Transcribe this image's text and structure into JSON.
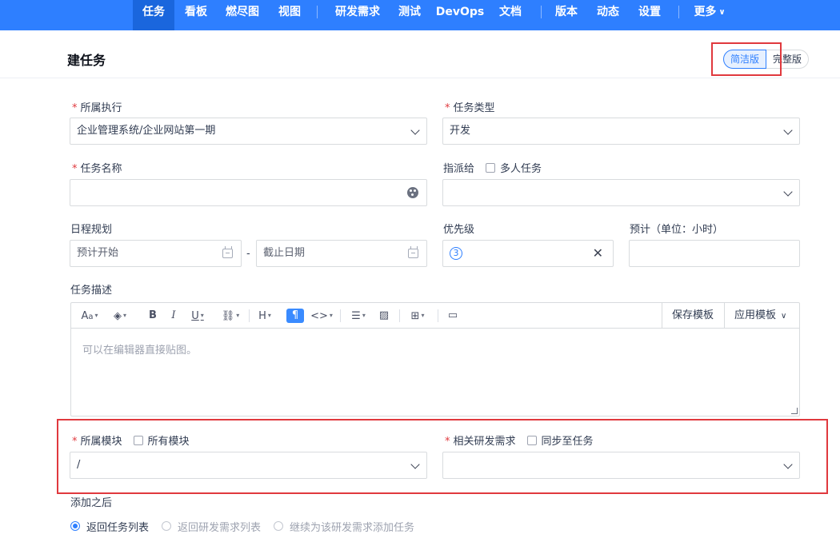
{
  "nav": {
    "items": [
      {
        "label": "任务",
        "active": true
      },
      {
        "label": "看板"
      },
      {
        "label": "燃尽图"
      },
      {
        "label": "视图"
      },
      {
        "label": "研发需求"
      },
      {
        "label": "测试"
      },
      {
        "label": "DevOps"
      },
      {
        "label": "文档"
      },
      {
        "label": "版本"
      },
      {
        "label": "动态"
      },
      {
        "label": "设置"
      },
      {
        "label": "更多"
      }
    ]
  },
  "header": {
    "title": "建任务",
    "view_simple": "简洁版",
    "view_full": "完整版"
  },
  "form": {
    "execution": {
      "label": "所属执行",
      "value": "企业管理系统/企业网站第一期"
    },
    "task_type": {
      "label": "任务类型",
      "value": "开发"
    },
    "task_name": {
      "label": "任务名称",
      "value": ""
    },
    "assign": {
      "label": "指派给",
      "multi_label": "多人任务",
      "value": ""
    },
    "schedule": {
      "label": "日程规划",
      "start_placeholder": "预计开始",
      "dash": "-",
      "end_placeholder": "截止日期"
    },
    "priority": {
      "label": "优先级",
      "value": "3"
    },
    "estimate": {
      "label": "预计（单位：小时）",
      "value": ""
    },
    "description": {
      "label": "任务描述",
      "placeholder": "可以在编辑器直接贴图。",
      "save_template": "保存模板",
      "apply_template": "应用模板"
    },
    "module": {
      "label": "所属模块",
      "all_label": "所有模块",
      "value": "/"
    },
    "story": {
      "label": "相关研发需求",
      "sync_label": "同步至任务",
      "value": ""
    },
    "after": {
      "label": "添加之后",
      "options": [
        "返回任务列表",
        "返回研发需求列表",
        "继续为该研发需求添加任务"
      ],
      "selected": 0
    }
  },
  "colors": {
    "primary": "#2e7fff",
    "required": "#e0393e",
    "highlight": "#e0393e"
  }
}
